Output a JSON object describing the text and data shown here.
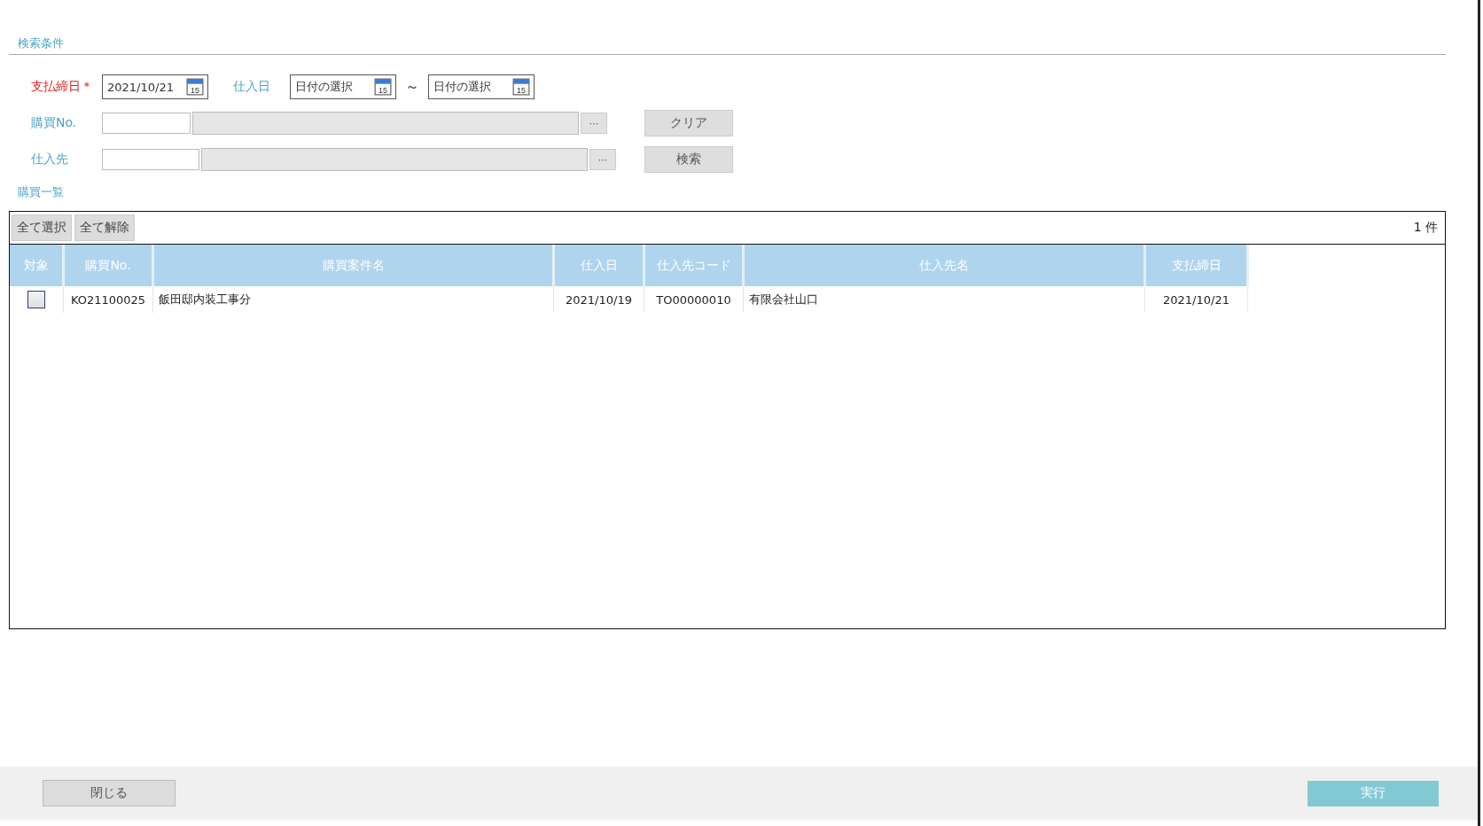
{
  "search_section": {
    "title": "検索条件"
  },
  "payment_close_date": {
    "label": "支払締日",
    "required_mark": "＊",
    "value": "2021/10/21"
  },
  "purchase_date": {
    "label": "仕入日",
    "from_placeholder": "日付の選択",
    "separator": "～",
    "to_placeholder": "日付の選択"
  },
  "purchase_no": {
    "label": "購買No.",
    "lookup": "···"
  },
  "supplier": {
    "label": "仕入先",
    "lookup": "···"
  },
  "buttons": {
    "clear": "クリア",
    "search": "検索"
  },
  "list_section": {
    "title": "購買一覧"
  },
  "grid": {
    "select_all": "全て選択",
    "deselect_all": "全て解除",
    "count": "1 件",
    "columns": [
      "対象",
      "購買No.",
      "購買案件名",
      "仕入日",
      "仕入先コード",
      "仕入先名",
      "支払締日"
    ],
    "rows": [
      {
        "checked": false,
        "purchase_no": "KO21100025",
        "project_name": "飯田邸内装工事分",
        "purchase_date": "2021/10/19",
        "supplier_code": "TO00000010",
        "supplier_name": "有限会社山口",
        "payment_close_date": "2021/10/21"
      }
    ]
  },
  "calendar_icon_days": [
    "15",
    "15",
    "15"
  ],
  "footer": {
    "close": "閉じる",
    "execute": "実行"
  }
}
